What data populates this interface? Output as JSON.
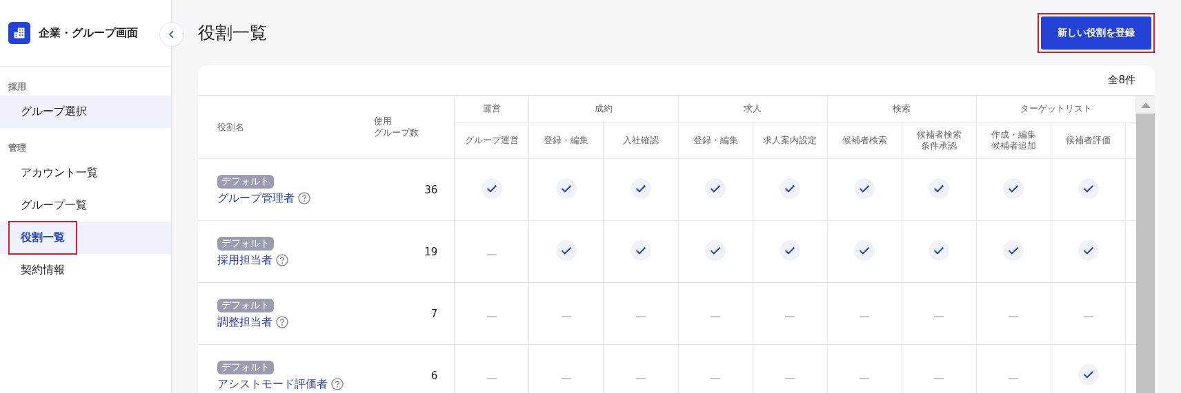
{
  "sidebar": {
    "title": "企業・グループ画面",
    "sections": [
      {
        "label": "採用",
        "items": [
          {
            "label": "グループ選択",
            "selected": false,
            "hovered": true,
            "outlined": false
          }
        ]
      },
      {
        "label": "管理",
        "items": [
          {
            "label": "アカウント一覧",
            "selected": false,
            "hovered": false,
            "outlined": false
          },
          {
            "label": "グループ一覧",
            "selected": false,
            "hovered": false,
            "outlined": false
          },
          {
            "label": "役割一覧",
            "selected": true,
            "hovered": false,
            "outlined": true
          },
          {
            "label": "契約情報",
            "selected": false,
            "hovered": false,
            "outlined": false
          }
        ]
      }
    ]
  },
  "page": {
    "title": "役割一覧",
    "primary_button": {
      "label": "新しい役割を登録",
      "outlined": true
    }
  },
  "table": {
    "count": "全8件",
    "name_header": "役割名",
    "count_header": [
      "使用",
      "グループ数"
    ],
    "groups": [
      {
        "label": "運営",
        "columns": [
          [
            "グループ運営"
          ]
        ]
      },
      {
        "label": "成約",
        "columns": [
          [
            "登録・編集"
          ],
          [
            "入社確認"
          ]
        ]
      },
      {
        "label": "求人",
        "columns": [
          [
            "登録・編集"
          ],
          [
            "求人案内設定"
          ]
        ]
      },
      {
        "label": "検索",
        "columns": [
          [
            "候補者検索"
          ],
          [
            "候補者検索",
            "条件承認"
          ]
        ]
      },
      {
        "label": "ターゲットリスト",
        "columns": [
          [
            "作成・編集",
            "候補者追加"
          ],
          [
            "候補者評価"
          ]
        ]
      }
    ],
    "rows": [
      {
        "badge": "デフォルト",
        "name": "グループ管理者",
        "groups": "36",
        "permissions": [
          true,
          true,
          true,
          true,
          true,
          true,
          true,
          true,
          true
        ]
      },
      {
        "badge": "デフォルト",
        "name": "採用担当者",
        "groups": "19",
        "permissions": [
          false,
          true,
          true,
          true,
          true,
          true,
          true,
          true,
          true
        ]
      },
      {
        "badge": "デフォルト",
        "name": "調整担当者",
        "groups": "7",
        "permissions": [
          false,
          false,
          false,
          false,
          false,
          false,
          false,
          false,
          false
        ]
      },
      {
        "badge": "デフォルト",
        "name": "アシストモード評価者",
        "groups": "6",
        "permissions": [
          false,
          false,
          false,
          false,
          false,
          false,
          false,
          false,
          true
        ]
      }
    ]
  }
}
